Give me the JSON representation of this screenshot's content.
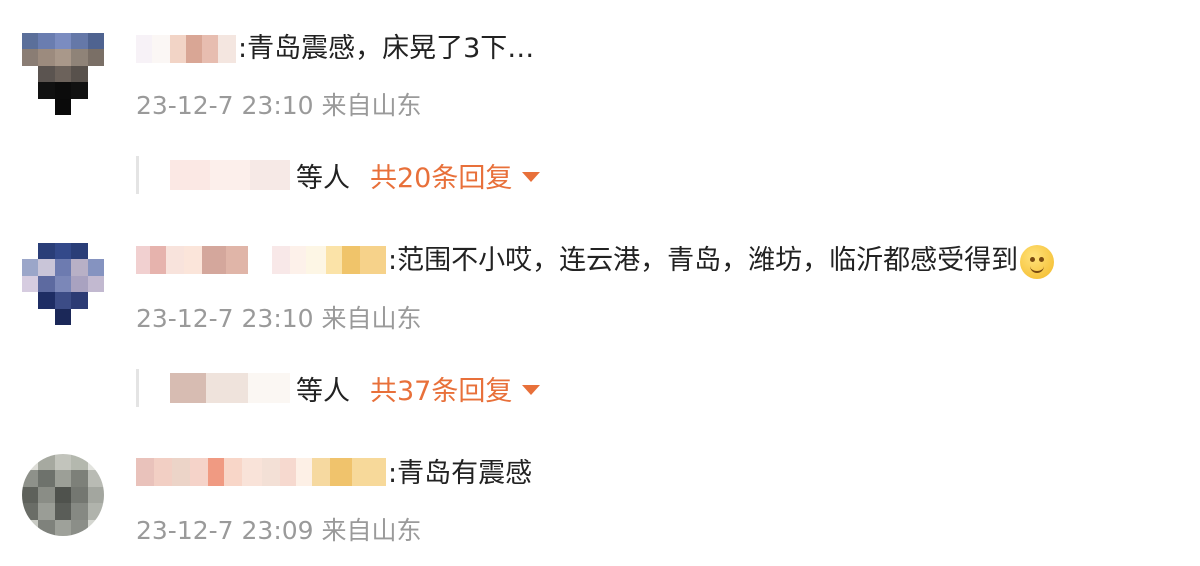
{
  "comments": [
    {
      "text": ":青岛震感，床晃了3下…",
      "meta": "23-12-7 23:10 来自山东",
      "reply_by_suffix": "等人",
      "reply_count_label": "共20条回复"
    },
    {
      "text": ":范围不小哎，连云港，青岛，潍坊，临沂都感受得到",
      "meta": "23-12-7 23:10 来自山东",
      "reply_by_suffix": "等人",
      "reply_count_label": "共37条回复",
      "emoji_icon": "smiling-face-icon"
    },
    {
      "text": ":青岛有震感",
      "meta": "23-12-7 23:09 来自山东"
    }
  ],
  "colors": {
    "accent": "#e8703a",
    "meta_text": "#9a9a9a",
    "body_text": "#222222"
  }
}
